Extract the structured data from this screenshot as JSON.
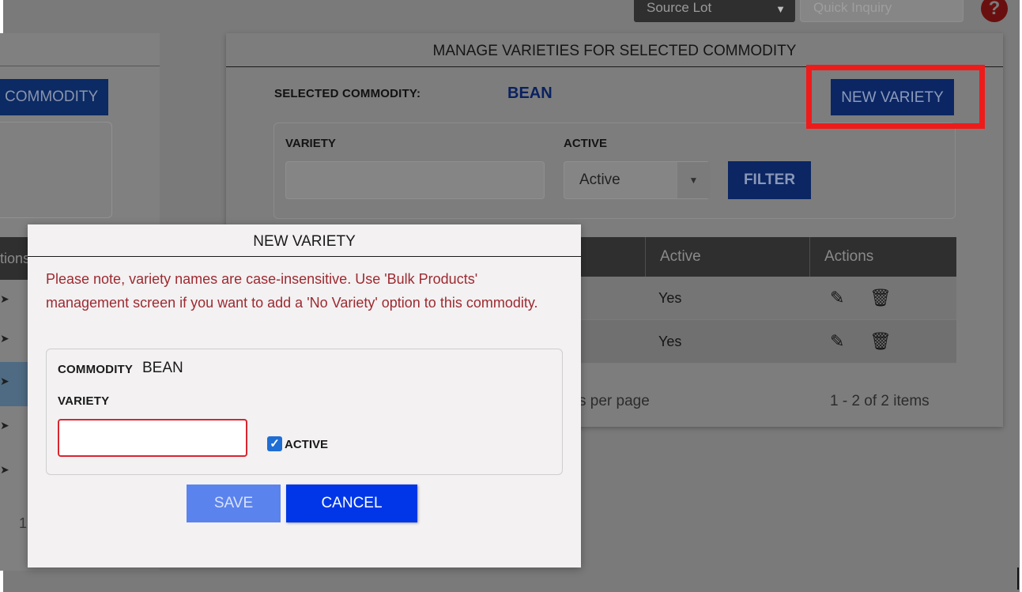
{
  "topbar": {
    "source_select_value": "Source Lot",
    "quick_inquiry_placeholder": "Quick Inquiry",
    "help_glyph": "?"
  },
  "left_panel": {
    "commodity_button_label": "COMMODITY",
    "table_header_fragment": "tions",
    "pager_fragment": "1"
  },
  "main_panel": {
    "title": "MANAGE VARIETIES FOR SELECTED COMMODITY",
    "selected_commodity_label": "SELECTED COMMODITY:",
    "selected_commodity_value": "BEAN",
    "new_variety_button": "NEW VARIETY",
    "filter": {
      "variety_label": "VARIETY",
      "active_label": "ACTIVE",
      "active_selected": "Active",
      "filter_button": "FILTER"
    },
    "table": {
      "columns": [
        "Active",
        "Actions"
      ],
      "rows": [
        {
          "active": "Yes"
        },
        {
          "active": "Yes"
        }
      ]
    },
    "pager": {
      "per_page_text": "s per page",
      "items_text": "1 - 2 of 2 items"
    }
  },
  "dialog": {
    "title": "NEW VARIETY",
    "note": "Please note, variety names are case-insensitive. Use 'Bulk Products' management screen if you want to add a 'No Variety' option to this commodity.",
    "commodity_label": "COMMODITY",
    "commodity_value": "BEAN",
    "variety_label": "VARIETY",
    "variety_value": "",
    "active_label": "ACTIVE",
    "active_checked": true,
    "save_button": "SAVE",
    "cancel_button": "CANCEL"
  },
  "icons": {
    "edit": "pencil-icon",
    "delete": "trash-icon",
    "dropdown": "caret-down-icon",
    "help": "help-icon",
    "check": "checkmark-icon"
  },
  "colors": {
    "primary_button": "#0036e8",
    "disabled_button": "#5b83ee",
    "warning_text": "#9d2a30",
    "highlight_box": "#ee1b1b",
    "overlay_bg": "#7a7a7a"
  }
}
